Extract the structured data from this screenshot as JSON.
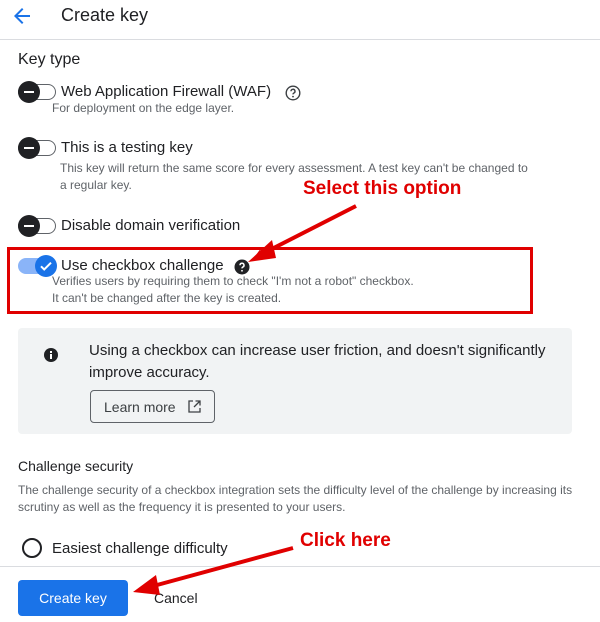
{
  "header": {
    "title": "Create key",
    "back_icon": "arrow-back-icon"
  },
  "key_type": {
    "title": "Key type",
    "options": [
      {
        "label": "Web Application Firewall (WAF)",
        "description": "For deployment on the edge layer.",
        "enabled": false
      },
      {
        "label": "This is a testing key",
        "description_line1": "This key will return the same score for every assessment. A test key can't be changed to",
        "description_line2": "a regular key.",
        "enabled": false
      },
      {
        "label": "Disable domain verification",
        "enabled": false
      },
      {
        "label": "Use checkbox challenge",
        "description_line1": "Verifies users by requiring them to check \"I'm not a robot\" checkbox.",
        "description_line2": "It can't be changed after the key is created.",
        "enabled": true
      }
    ]
  },
  "info": {
    "text": "Using a checkbox can increase user friction, and doesn't significantly improve accuracy.",
    "learn_more": "Learn more"
  },
  "challenge_security": {
    "title": "Challenge security",
    "description": "The challenge security of a checkbox integration sets the difficulty level of the challenge by increasing its scrutiny as well as the frequency it is presented to your users.",
    "radio_label": "Easiest challenge difficulty"
  },
  "footer": {
    "create_label": "Create key",
    "cancel_label": "Cancel"
  },
  "annotations": {
    "select": "Select this option",
    "click": "Click here",
    "color": "#e00000"
  },
  "colors": {
    "primary": "#1a73e8",
    "toggle_on_track": "#8ab4f8"
  }
}
